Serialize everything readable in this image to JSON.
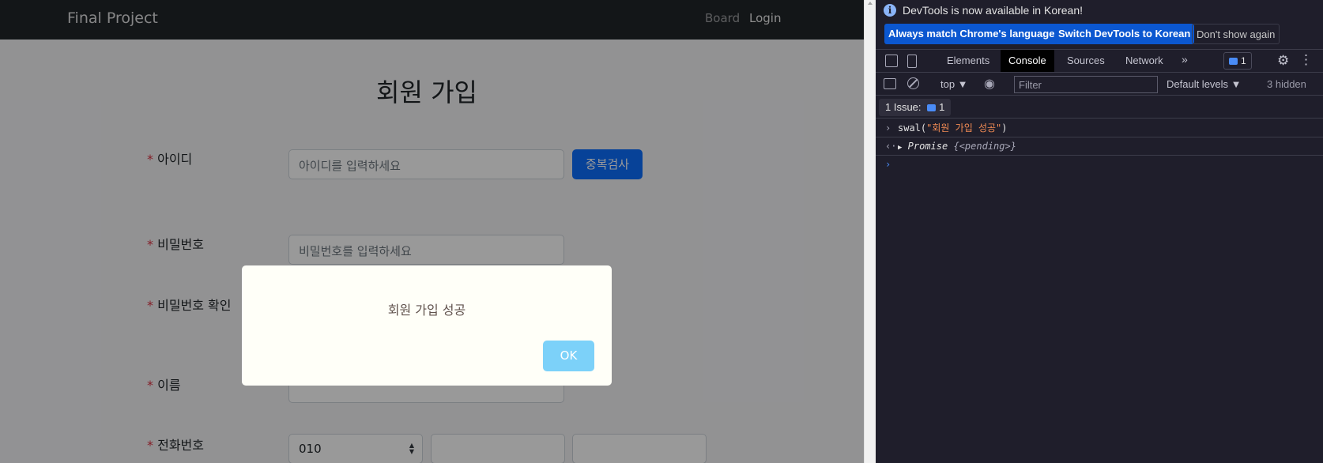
{
  "navbar": {
    "brand": "Final Project",
    "links": {
      "board": "Board",
      "login": "Login"
    }
  },
  "form": {
    "title": "회원 가입",
    "required_mark": "*",
    "fields": {
      "id": {
        "label": "아이디",
        "placeholder": "아이디를 입력하세요",
        "check_button": "중복검사"
      },
      "password": {
        "label": "비밀번호",
        "placeholder": "비밀번호를 입력하세요"
      },
      "password_confirm": {
        "label": "비밀번호 확인"
      },
      "name": {
        "label": "이름"
      },
      "phone": {
        "label": "전화번호",
        "prefix": "010"
      }
    }
  },
  "modal": {
    "message": "회원 가입 성공",
    "ok_label": "OK"
  },
  "devtools": {
    "infobar": {
      "message": "DevTools is now available in Korean!",
      "btn_match": "Always match Chrome's language",
      "btn_switch": "Switch DevTools to Korean",
      "btn_dont": "Don't show again"
    },
    "tabs": [
      "Elements",
      "Console",
      "Sources",
      "Network"
    ],
    "active_tab": "Console",
    "more_tabs": "»",
    "issues_count": "1",
    "toolbar": {
      "context": "top ▼",
      "filter_placeholder": "Filter",
      "levels": "Default levels ▼",
      "hidden": "3 hidden"
    },
    "issue_bar": {
      "label": "1 Issue:",
      "count": "1"
    },
    "console": {
      "command_fn": "swal(",
      "command_arg": "\"회원 가입 성공\"",
      "command_close": ")",
      "result_label": "Promise",
      "result_state": "{<pending>}"
    }
  }
}
